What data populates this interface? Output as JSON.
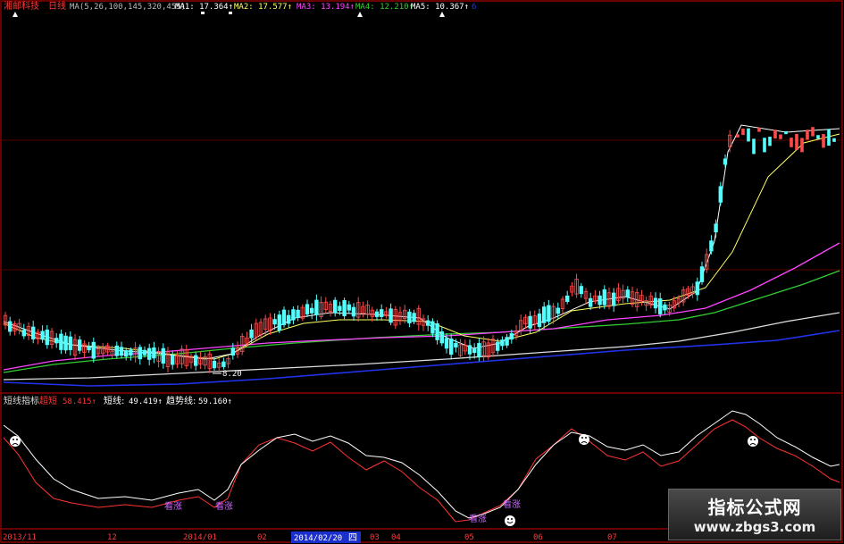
{
  "header": {
    "stock_name": "湘邮科技",
    "period": "日线",
    "ma_params": "MA(5,26,100,145,320,455)",
    "ma1": "MA1: 17.364↑",
    "ma2": "MA2: 17.577↑",
    "ma3": "MA3: 13.194↑",
    "ma4": "MA4: 12.210↑",
    "ma5": "MA5: 10.367↑",
    "ma6": "6"
  },
  "indicator": {
    "name": "短线指标",
    "l1": "超短",
    "v1": "58.415↑",
    "l2": "短线:",
    "v2": "49.419↑",
    "l3": "趋势线:",
    "v3": "59.160↑",
    "signals": [
      "看涨",
      "看涨",
      "看涨",
      "看涨"
    ]
  },
  "low_label": "8.20",
  "xaxis": {
    "labels": [
      "2013/11",
      "12",
      "2014/01",
      "02",
      "03",
      "04",
      "05",
      "06",
      "07"
    ],
    "cursor_date": "2014/02/20",
    "cursor_day": "四"
  },
  "watermark": {
    "title": "指标公式网",
    "url": "www.zbgs3.com"
  },
  "colors": {
    "up": "#ff4a4a",
    "down": "#54ffff",
    "ma1": "#ffffff",
    "ma2": "#ffff66",
    "ma3": "#ff44ff",
    "ma4": "#33cc33",
    "ma5": "#ffffff",
    "ma6": "#2233ee",
    "frame": "#8b0000",
    "osc_fast": "#ffffff",
    "osc_slow": "#ff3333"
  },
  "chart_data": [
    {
      "type": "candlestick",
      "title": "湘邮科技 日线",
      "x": [
        "2013/11",
        "12",
        "2014/01",
        "02",
        "03",
        "04",
        "05",
        "06",
        "07"
      ],
      "series": [
        {
          "name": "MA1",
          "values": [
            9.6,
            9.4,
            9.0,
            9.2,
            10.6,
            10.8,
            10.0,
            11.2,
            17.4
          ]
        },
        {
          "name": "MA2",
          "values": [
            9.4,
            9.2,
            9.0,
            8.9,
            9.8,
            10.2,
            10.0,
            10.4,
            17.6
          ]
        },
        {
          "name": "MA3",
          "values": [
            8.2,
            8.4,
            8.8,
            9.2,
            9.4,
            9.5,
            9.7,
            10.6,
            13.2
          ]
        },
        {
          "name": "MA4",
          "values": [
            7.9,
            8.2,
            8.6,
            9.0,
            9.2,
            9.3,
            9.5,
            10.2,
            12.2
          ]
        },
        {
          "name": "MA5",
          "values": [
            7.9,
            8.1,
            8.3,
            8.5,
            8.7,
            8.9,
            9.1,
            9.5,
            10.4
          ]
        }
      ],
      "annotations": [
        "8.20"
      ]
    },
    {
      "type": "line",
      "title": "短线指标",
      "x": [
        "2013/11",
        "12",
        "2014/01",
        "02",
        "03",
        "04",
        "05",
        "06",
        "07"
      ],
      "series": [
        {
          "name": "超短",
          "values": [
            85,
            20,
            15,
            85,
            60,
            70,
            10,
            90,
            58
          ]
        },
        {
          "name": "短线",
          "values": [
            80,
            25,
            18,
            80,
            62,
            68,
            12,
            85,
            49
          ]
        }
      ]
    }
  ]
}
